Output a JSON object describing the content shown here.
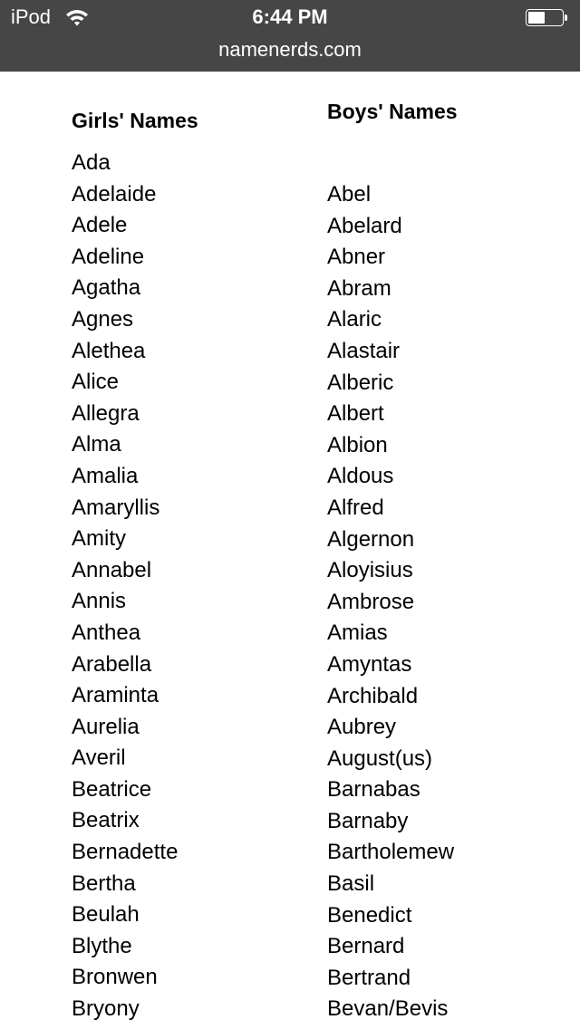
{
  "status_bar": {
    "carrier": "iPod",
    "wifi_icon": "wifi-icon",
    "time": "6:44 PM",
    "battery_icon": "battery-icon",
    "battery_level": 0.5
  },
  "browser": {
    "url": "namenerds.com"
  },
  "girls": {
    "heading": "Girls' Names",
    "names": [
      "Ada",
      "Adelaide",
      "Adele",
      "Adeline",
      "Agatha",
      "Agnes",
      "Alethea",
      "Alice",
      "Allegra",
      "Alma",
      "Amalia",
      "Amaryllis",
      "Amity",
      "Annabel",
      "Annis",
      "Anthea",
      "Arabella",
      "Araminta",
      "Aurelia",
      "Averil",
      "Beatrice",
      "Beatrix",
      "Bernadette",
      "Bertha",
      "Beulah",
      "Blythe",
      "Bronwen",
      "Bryony"
    ]
  },
  "boys": {
    "heading": "Boys' Names",
    "names": [
      "Abel",
      "Abelard",
      "Abner",
      "Abram",
      "Alaric",
      "Alastair",
      "Alberic",
      "Albert",
      "Albion",
      "Aldous",
      "Alfred",
      "Algernon",
      "Aloyisius",
      "Ambrose",
      "Amias",
      "Amyntas",
      "Archibald",
      "Aubrey",
      "August(us)",
      "Barnabas",
      "Barnaby",
      "Bartholemew",
      "Basil",
      "Benedict",
      "Bernard",
      "Bertrand",
      "Bevan/Bevis"
    ]
  }
}
